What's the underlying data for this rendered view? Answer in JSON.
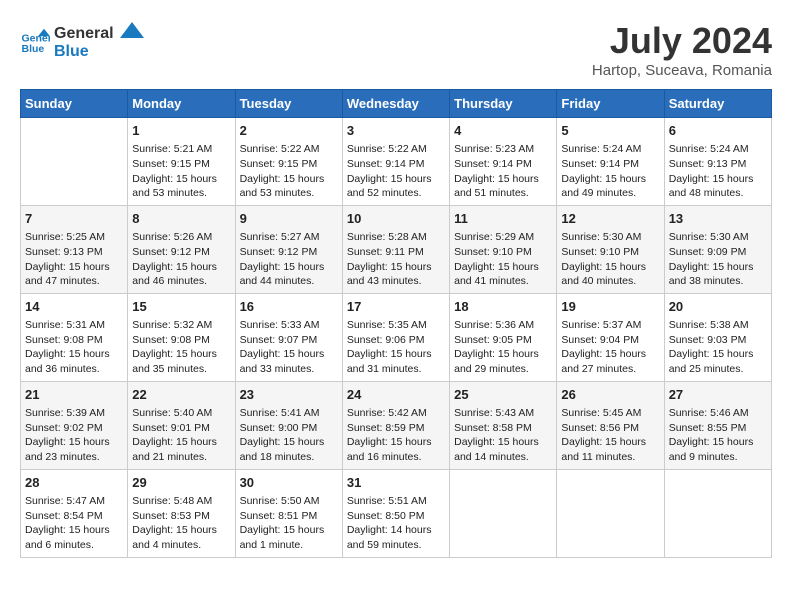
{
  "header": {
    "logo_line1": "General",
    "logo_line2": "Blue",
    "month_year": "July 2024",
    "location": "Hartop, Suceava, Romania"
  },
  "weekdays": [
    "Sunday",
    "Monday",
    "Tuesday",
    "Wednesday",
    "Thursday",
    "Friday",
    "Saturday"
  ],
  "weeks": [
    [
      {
        "day": "",
        "sunrise": "",
        "sunset": "",
        "daylight": ""
      },
      {
        "day": "1",
        "sunrise": "Sunrise: 5:21 AM",
        "sunset": "Sunset: 9:15 PM",
        "daylight": "Daylight: 15 hours and 53 minutes."
      },
      {
        "day": "2",
        "sunrise": "Sunrise: 5:22 AM",
        "sunset": "Sunset: 9:15 PM",
        "daylight": "Daylight: 15 hours and 53 minutes."
      },
      {
        "day": "3",
        "sunrise": "Sunrise: 5:22 AM",
        "sunset": "Sunset: 9:14 PM",
        "daylight": "Daylight: 15 hours and 52 minutes."
      },
      {
        "day": "4",
        "sunrise": "Sunrise: 5:23 AM",
        "sunset": "Sunset: 9:14 PM",
        "daylight": "Daylight: 15 hours and 51 minutes."
      },
      {
        "day": "5",
        "sunrise": "Sunrise: 5:24 AM",
        "sunset": "Sunset: 9:14 PM",
        "daylight": "Daylight: 15 hours and 49 minutes."
      },
      {
        "day": "6",
        "sunrise": "Sunrise: 5:24 AM",
        "sunset": "Sunset: 9:13 PM",
        "daylight": "Daylight: 15 hours and 48 minutes."
      }
    ],
    [
      {
        "day": "7",
        "sunrise": "Sunrise: 5:25 AM",
        "sunset": "Sunset: 9:13 PM",
        "daylight": "Daylight: 15 hours and 47 minutes."
      },
      {
        "day": "8",
        "sunrise": "Sunrise: 5:26 AM",
        "sunset": "Sunset: 9:12 PM",
        "daylight": "Daylight: 15 hours and 46 minutes."
      },
      {
        "day": "9",
        "sunrise": "Sunrise: 5:27 AM",
        "sunset": "Sunset: 9:12 PM",
        "daylight": "Daylight: 15 hours and 44 minutes."
      },
      {
        "day": "10",
        "sunrise": "Sunrise: 5:28 AM",
        "sunset": "Sunset: 9:11 PM",
        "daylight": "Daylight: 15 hours and 43 minutes."
      },
      {
        "day": "11",
        "sunrise": "Sunrise: 5:29 AM",
        "sunset": "Sunset: 9:10 PM",
        "daylight": "Daylight: 15 hours and 41 minutes."
      },
      {
        "day": "12",
        "sunrise": "Sunrise: 5:30 AM",
        "sunset": "Sunset: 9:10 PM",
        "daylight": "Daylight: 15 hours and 40 minutes."
      },
      {
        "day": "13",
        "sunrise": "Sunrise: 5:30 AM",
        "sunset": "Sunset: 9:09 PM",
        "daylight": "Daylight: 15 hours and 38 minutes."
      }
    ],
    [
      {
        "day": "14",
        "sunrise": "Sunrise: 5:31 AM",
        "sunset": "Sunset: 9:08 PM",
        "daylight": "Daylight: 15 hours and 36 minutes."
      },
      {
        "day": "15",
        "sunrise": "Sunrise: 5:32 AM",
        "sunset": "Sunset: 9:08 PM",
        "daylight": "Daylight: 15 hours and 35 minutes."
      },
      {
        "day": "16",
        "sunrise": "Sunrise: 5:33 AM",
        "sunset": "Sunset: 9:07 PM",
        "daylight": "Daylight: 15 hours and 33 minutes."
      },
      {
        "day": "17",
        "sunrise": "Sunrise: 5:35 AM",
        "sunset": "Sunset: 9:06 PM",
        "daylight": "Daylight: 15 hours and 31 minutes."
      },
      {
        "day": "18",
        "sunrise": "Sunrise: 5:36 AM",
        "sunset": "Sunset: 9:05 PM",
        "daylight": "Daylight: 15 hours and 29 minutes."
      },
      {
        "day": "19",
        "sunrise": "Sunrise: 5:37 AM",
        "sunset": "Sunset: 9:04 PM",
        "daylight": "Daylight: 15 hours and 27 minutes."
      },
      {
        "day": "20",
        "sunrise": "Sunrise: 5:38 AM",
        "sunset": "Sunset: 9:03 PM",
        "daylight": "Daylight: 15 hours and 25 minutes."
      }
    ],
    [
      {
        "day": "21",
        "sunrise": "Sunrise: 5:39 AM",
        "sunset": "Sunset: 9:02 PM",
        "daylight": "Daylight: 15 hours and 23 minutes."
      },
      {
        "day": "22",
        "sunrise": "Sunrise: 5:40 AM",
        "sunset": "Sunset: 9:01 PM",
        "daylight": "Daylight: 15 hours and 21 minutes."
      },
      {
        "day": "23",
        "sunrise": "Sunrise: 5:41 AM",
        "sunset": "Sunset: 9:00 PM",
        "daylight": "Daylight: 15 hours and 18 minutes."
      },
      {
        "day": "24",
        "sunrise": "Sunrise: 5:42 AM",
        "sunset": "Sunset: 8:59 PM",
        "daylight": "Daylight: 15 hours and 16 minutes."
      },
      {
        "day": "25",
        "sunrise": "Sunrise: 5:43 AM",
        "sunset": "Sunset: 8:58 PM",
        "daylight": "Daylight: 15 hours and 14 minutes."
      },
      {
        "day": "26",
        "sunrise": "Sunrise: 5:45 AM",
        "sunset": "Sunset: 8:56 PM",
        "daylight": "Daylight: 15 hours and 11 minutes."
      },
      {
        "day": "27",
        "sunrise": "Sunrise: 5:46 AM",
        "sunset": "Sunset: 8:55 PM",
        "daylight": "Daylight: 15 hours and 9 minutes."
      }
    ],
    [
      {
        "day": "28",
        "sunrise": "Sunrise: 5:47 AM",
        "sunset": "Sunset: 8:54 PM",
        "daylight": "Daylight: 15 hours and 6 minutes."
      },
      {
        "day": "29",
        "sunrise": "Sunrise: 5:48 AM",
        "sunset": "Sunset: 8:53 PM",
        "daylight": "Daylight: 15 hours and 4 minutes."
      },
      {
        "day": "30",
        "sunrise": "Sunrise: 5:50 AM",
        "sunset": "Sunset: 8:51 PM",
        "daylight": "Daylight: 15 hours and 1 minute."
      },
      {
        "day": "31",
        "sunrise": "Sunrise: 5:51 AM",
        "sunset": "Sunset: 8:50 PM",
        "daylight": "Daylight: 14 hours and 59 minutes."
      },
      {
        "day": "",
        "sunrise": "",
        "sunset": "",
        "daylight": ""
      },
      {
        "day": "",
        "sunrise": "",
        "sunset": "",
        "daylight": ""
      },
      {
        "day": "",
        "sunrise": "",
        "sunset": "",
        "daylight": ""
      }
    ]
  ]
}
